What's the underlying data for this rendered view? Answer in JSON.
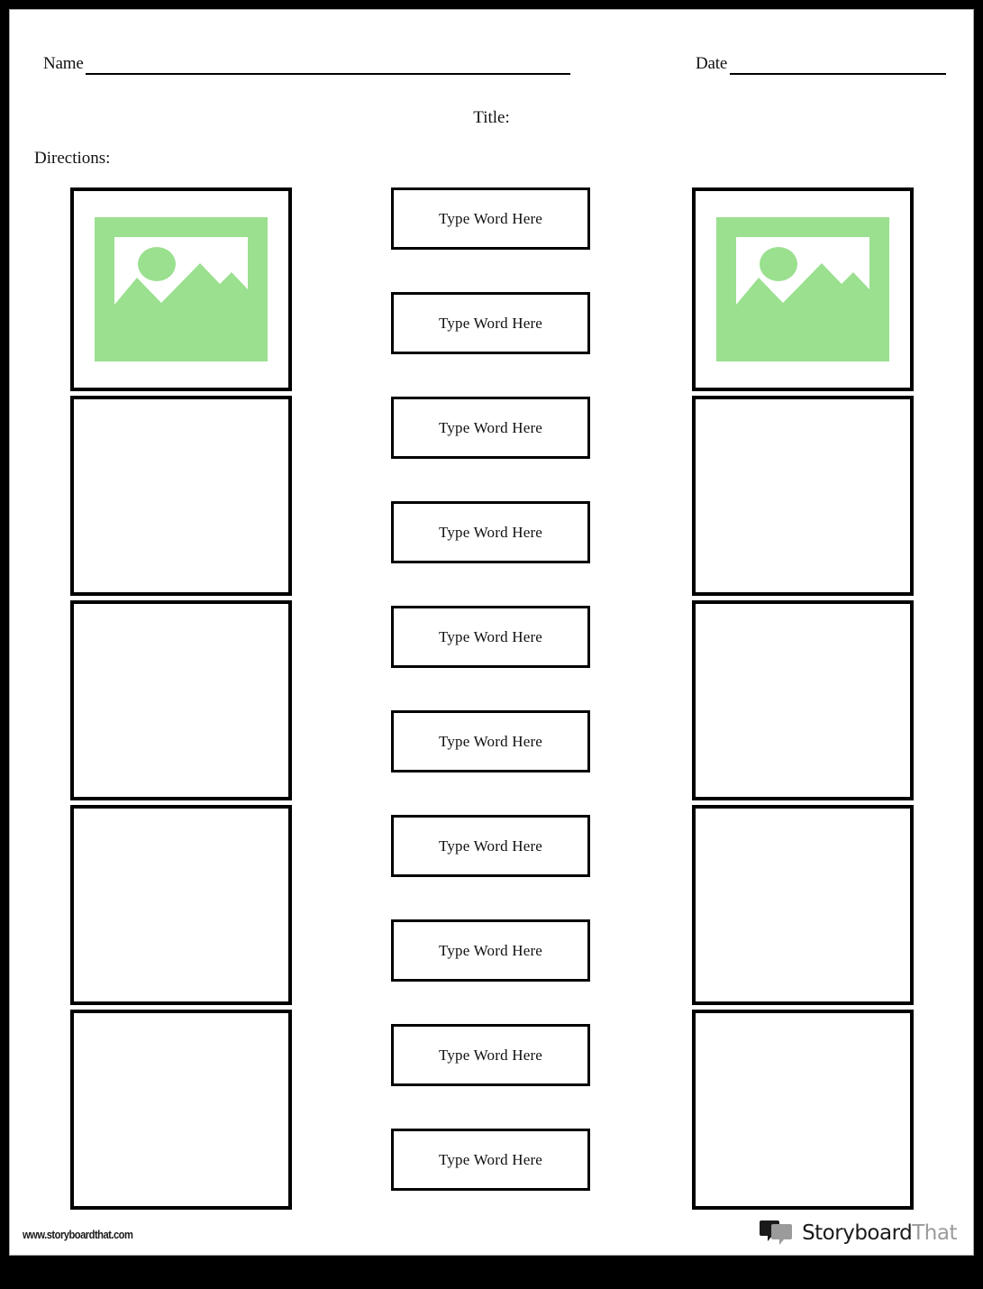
{
  "page": {
    "background_color": "#000000",
    "sheet_color": "#ffffff",
    "accent_green": "#9ae08f"
  },
  "header": {
    "name_label": "Name",
    "date_label": "Date",
    "title_label": "Title:",
    "directions_label": "Directions:"
  },
  "columns": {
    "left": {
      "cells": [
        {
          "type": "image-placeholder",
          "icon": "image-placeholder-icon"
        },
        {
          "type": "blank"
        },
        {
          "type": "blank"
        },
        {
          "type": "blank"
        },
        {
          "type": "blank"
        }
      ]
    },
    "middle": {
      "word_boxes": [
        {
          "text": "Type Word Here"
        },
        {
          "text": "Type Word Here"
        },
        {
          "text": "Type Word Here"
        },
        {
          "text": "Type Word Here"
        },
        {
          "text": "Type Word Here"
        },
        {
          "text": "Type Word Here"
        },
        {
          "text": "Type Word Here"
        },
        {
          "text": "Type Word Here"
        },
        {
          "text": "Type Word Here"
        },
        {
          "text": "Type Word Here"
        }
      ]
    },
    "right": {
      "cells": [
        {
          "type": "image-placeholder",
          "icon": "image-placeholder-icon"
        },
        {
          "type": "blank"
        },
        {
          "type": "blank"
        },
        {
          "type": "blank"
        },
        {
          "type": "blank"
        }
      ]
    }
  },
  "footer": {
    "url": "www.storyboardthat.com",
    "brand_primary": "Storyboard",
    "brand_secondary": "That",
    "brand_icon": "speech-bubbles-icon"
  }
}
